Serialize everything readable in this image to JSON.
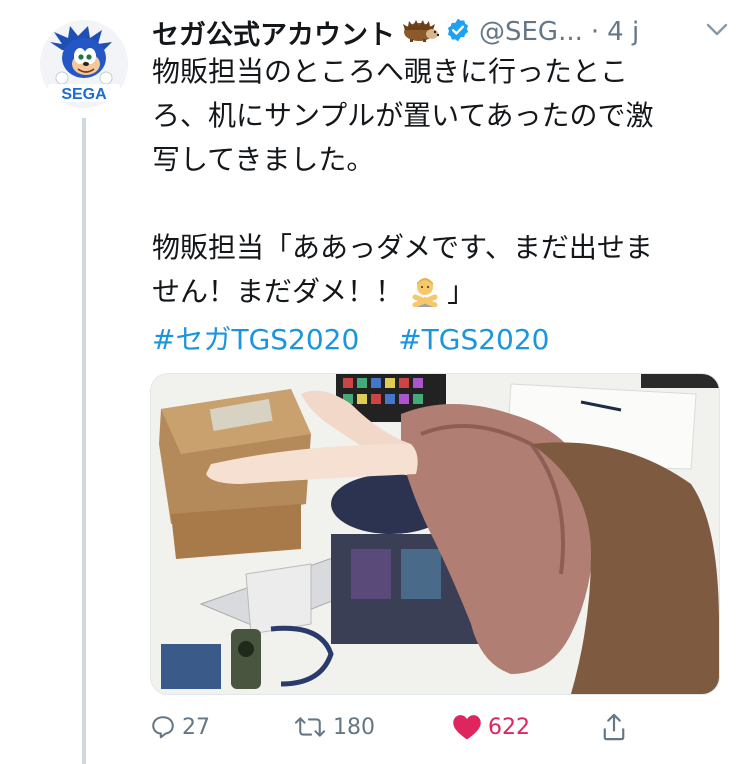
{
  "account": {
    "name": "セガ公式アカウント",
    "emoji_icon": "hedgehog-emoji",
    "verified_icon": "verified-badge-icon",
    "handle": "@SEG...",
    "separator": "·",
    "time": "4 j",
    "avatar_logo_text": "SEGA"
  },
  "tweet": {
    "lines": [
      "物販担当のところへ覗きに行ったとこ",
      "ろ、机にサンプルが置いてあったので激",
      "写してきました。",
      "",
      "物販担当「ああっダメです、まだ出せま",
      "せん！まだダメ！！",
      "」"
    ],
    "hashtags": [
      "#セガTGS2020",
      "#TGS2020"
    ]
  },
  "actions": {
    "reply_count": "27",
    "retweet_count": "180",
    "like_count": "622"
  },
  "colors": {
    "link": "#1b95e0",
    "like": "#e0245e",
    "muted": "#657786",
    "verified": "#1da1f2"
  }
}
